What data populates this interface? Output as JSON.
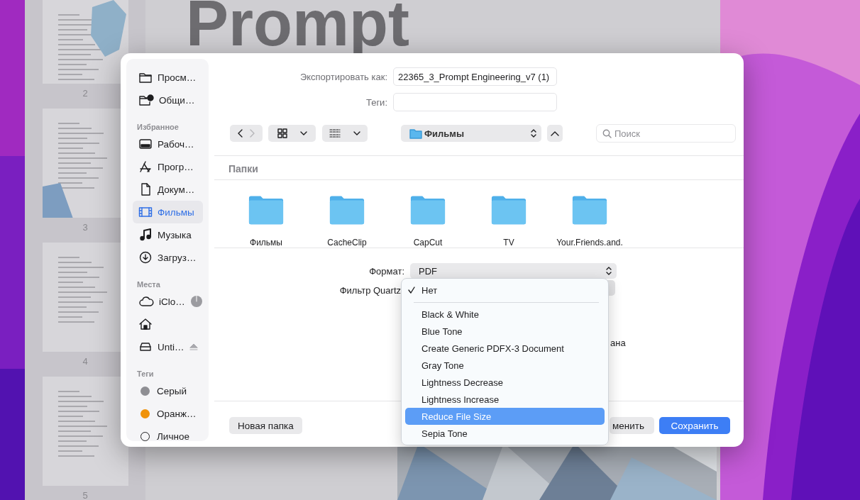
{
  "document": {
    "title": "Prompt",
    "page_numbers": [
      "2",
      "3",
      "4",
      "5"
    ]
  },
  "dialog": {
    "sidebar": {
      "sections": [
        {
          "items": [
            {
              "label": "Просм…",
              "selected": false
            },
            {
              "label": "Общи…",
              "selected": false
            }
          ]
        },
        {
          "heading": "Избранное",
          "items": [
            {
              "label": "Рабоч…",
              "selected": false
            },
            {
              "label": "Прогр…",
              "selected": false
            },
            {
              "label": "Докум…",
              "selected": false
            },
            {
              "label": "Фильмы",
              "selected": true
            },
            {
              "label": "Музыка",
              "selected": false
            },
            {
              "label": "Загруз…",
              "selected": false
            }
          ]
        },
        {
          "heading": "Места",
          "items": [
            {
              "label": "iClo…",
              "selected": false
            },
            {
              "selected": false
            },
            {
              "label": "Unti…",
              "selected": false
            }
          ]
        },
        {
          "heading": "Теги",
          "items": [
            {
              "label": "Серый",
              "selected": false,
              "color": "#8e8e93"
            },
            {
              "label": "Оранж…",
              "selected": false,
              "color": "#f0930a"
            },
            {
              "label": "Личное",
              "selected": false
            }
          ]
        }
      ]
    },
    "export_as": {
      "label": "Экспортировать как:",
      "value": "22365_3_Prompt Engineering_v7 (1)"
    },
    "tags": {
      "label": "Теги:"
    },
    "toolbar": {
      "location": "Фильмы",
      "search": {
        "placeholder": "Поиск"
      }
    },
    "section_title": "Папки",
    "folders": [
      "Фильмы",
      "CacheClip",
      "CapCut",
      "TV",
      "Your.Friends.and."
    ],
    "format": {
      "label": "Формат:",
      "value": "PDF"
    },
    "filter": {
      "label": "Фильтр Quartz"
    },
    "hidden_text": "ана",
    "buttons": {
      "new_folder": "Новая папка",
      "cancel": "менить",
      "save": "Сохранить"
    },
    "menu": {
      "items": [
        {
          "kind": "item",
          "label": "Нет",
          "checked": true,
          "selected": false
        },
        {
          "kind": "separator"
        },
        {
          "kind": "item",
          "label": "Black & White",
          "checked": false,
          "selected": false
        },
        {
          "kind": "item",
          "label": "Blue Tone",
          "checked": false,
          "selected": false
        },
        {
          "kind": "item",
          "label": "Create Generic PDFX-3 Document",
          "checked": false,
          "selected": false
        },
        {
          "kind": "item",
          "label": "Gray Tone",
          "checked": false,
          "selected": false
        },
        {
          "kind": "item",
          "label": "Lightness Decrease",
          "checked": false,
          "selected": false
        },
        {
          "kind": "item",
          "label": "Lightness Increase",
          "checked": false,
          "selected": false
        },
        {
          "kind": "item",
          "label": "Reduce File Size",
          "checked": false,
          "selected": true
        },
        {
          "kind": "item",
          "label": "Sepia Tone",
          "checked": false,
          "selected": false
        }
      ]
    }
  }
}
